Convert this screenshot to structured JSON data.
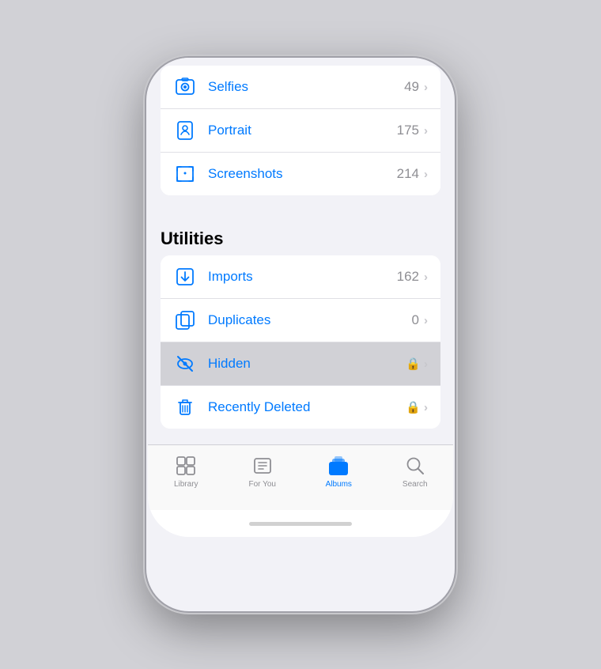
{
  "phone": {
    "background": "#d1d1d6"
  },
  "list": {
    "items_top": [
      {
        "id": "selfies",
        "label": "Selfies",
        "count": "49",
        "icon": "selfies",
        "hasLock": false
      },
      {
        "id": "portrait",
        "label": "Portrait",
        "count": "175",
        "icon": "portrait",
        "hasLock": false
      },
      {
        "id": "screenshots",
        "label": "Screenshots",
        "count": "214",
        "icon": "screenshots",
        "hasLock": false
      }
    ],
    "utilities_header": "Utilities",
    "utilities_items": [
      {
        "id": "imports",
        "label": "Imports",
        "count": "162",
        "icon": "imports",
        "hasLock": false,
        "highlighted": false
      },
      {
        "id": "duplicates",
        "label": "Duplicates",
        "count": "0",
        "icon": "duplicates",
        "hasLock": false,
        "highlighted": false
      },
      {
        "id": "hidden",
        "label": "Hidden",
        "count": "",
        "icon": "hidden",
        "hasLock": true,
        "highlighted": true
      },
      {
        "id": "recently-deleted",
        "label": "Recently Deleted",
        "count": "",
        "icon": "recently-deleted",
        "hasLock": true,
        "highlighted": false
      }
    ]
  },
  "tabs": [
    {
      "id": "library",
      "label": "Library",
      "active": false
    },
    {
      "id": "for-you",
      "label": "For You",
      "active": false
    },
    {
      "id": "albums",
      "label": "Albums",
      "active": true
    },
    {
      "id": "search",
      "label": "Search",
      "active": false
    }
  ]
}
